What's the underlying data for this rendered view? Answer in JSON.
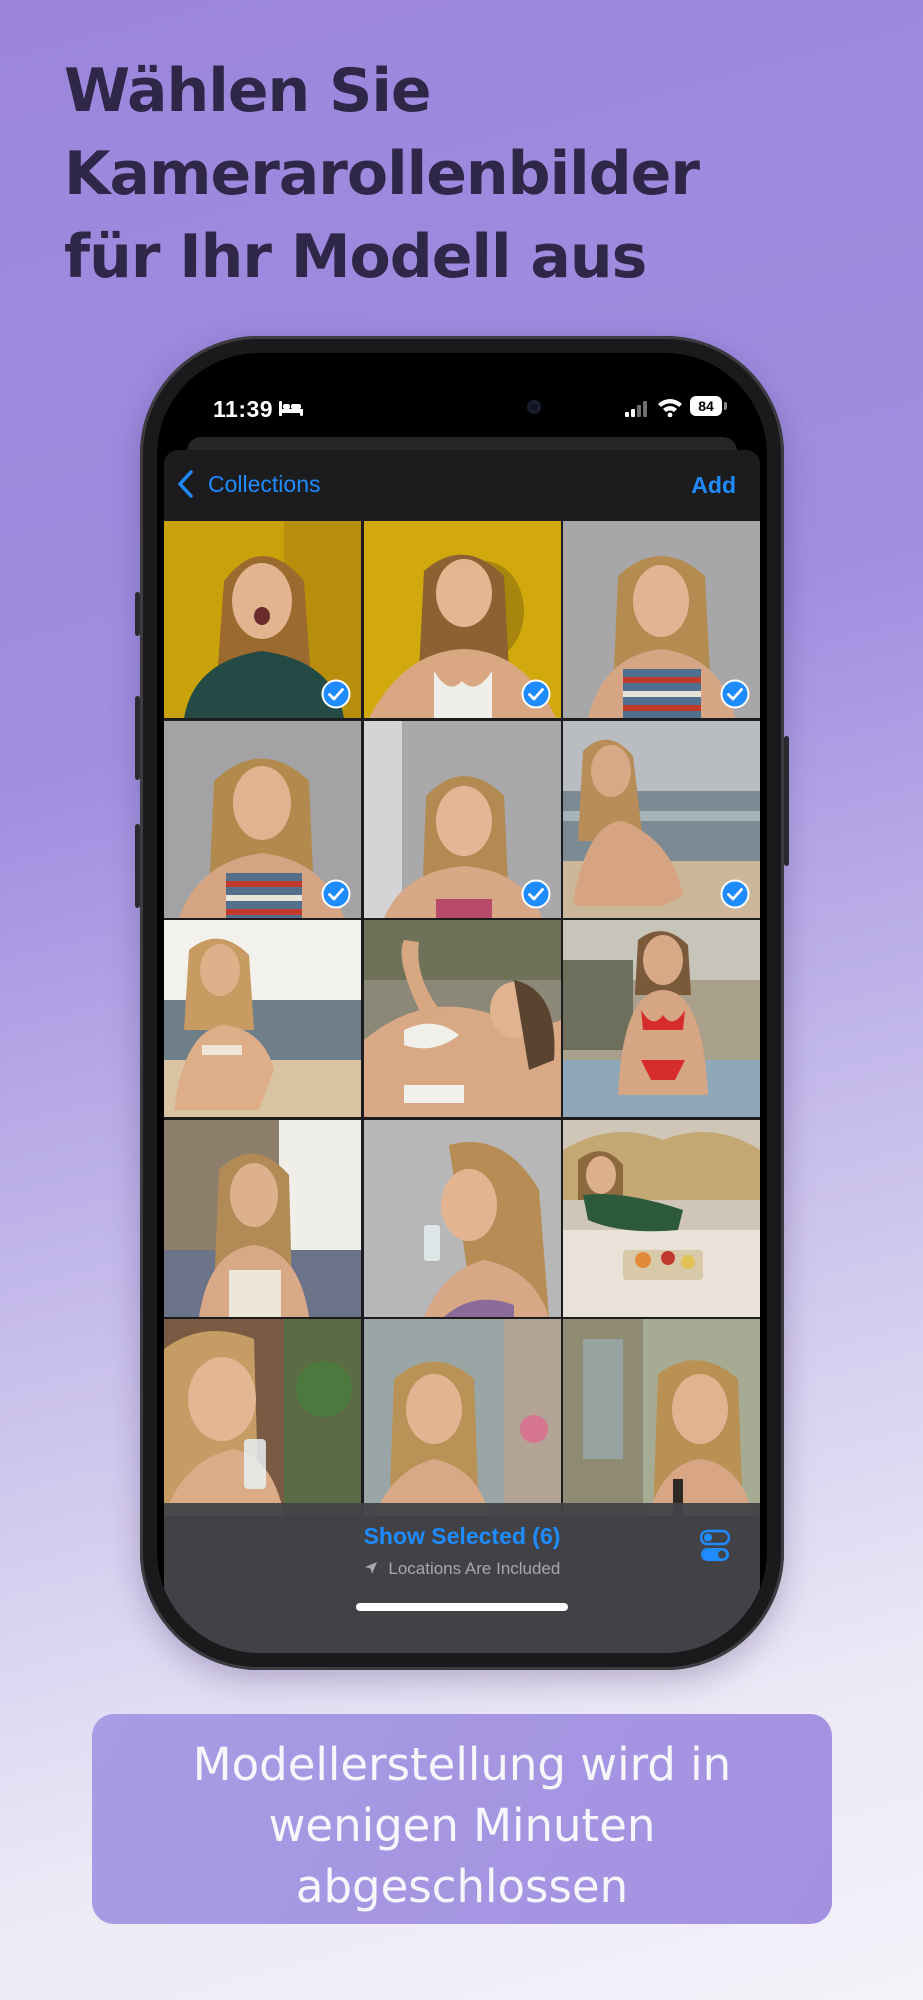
{
  "headline": {
    "line1": "Wählen Sie",
    "line2": "Kamerarollenbilder",
    "line3": "für Ihr Modell aus"
  },
  "status_bar": {
    "time": "11:39",
    "battery": "84"
  },
  "nav": {
    "back_label": "Collections",
    "add_label": "Add"
  },
  "accent_color": "#1e8bff",
  "photos": [
    {
      "selected": true
    },
    {
      "selected": true
    },
    {
      "selected": true
    },
    {
      "selected": true
    },
    {
      "selected": true
    },
    {
      "selected": true
    },
    {
      "selected": false
    },
    {
      "selected": false
    },
    {
      "selected": false
    },
    {
      "selected": false
    },
    {
      "selected": false
    },
    {
      "selected": false
    },
    {
      "selected": false
    },
    {
      "selected": false
    },
    {
      "selected": false
    }
  ],
  "bottom_bar": {
    "show_selected": "Show Selected (6)",
    "locations_note": "Locations Are Included"
  },
  "banner": {
    "line1": "Modellerstellung wird in",
    "line2": "wenigen Minuten",
    "line3": "abgeschlossen"
  }
}
